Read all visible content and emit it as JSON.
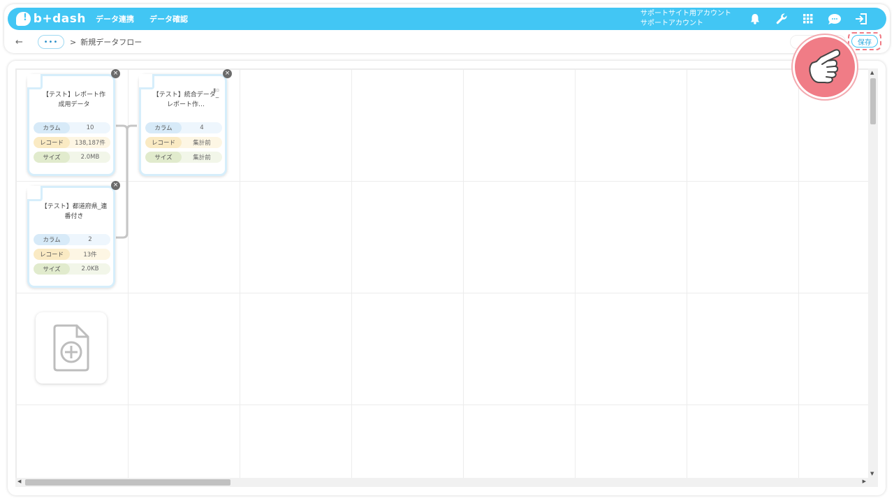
{
  "header": {
    "logo_text": "b+dash",
    "nav": [
      "データ連携",
      "データ確認"
    ],
    "account_line1": "サポートサイト用アカウント",
    "account_line2": "サポートアカウント",
    "icons": [
      "bell-icon",
      "wrench-icon",
      "grid-icon",
      "chat-icon",
      "logout-icon"
    ],
    "accent_color": "#42c6f4"
  },
  "breadcrumb": {
    "back": "←",
    "more": "•••",
    "separator": ">",
    "current": "新規データフロー"
  },
  "toolbar": {
    "save_label": "保存"
  },
  "cards": [
    {
      "title": "【テスト】レポート作成用データ",
      "rows": [
        {
          "key": "カラム",
          "value": "10"
        },
        {
          "key": "レコード",
          "value": "138,187件"
        },
        {
          "key": "サイズ",
          "value": "2.0MB"
        }
      ]
    },
    {
      "title": "【テスト】統合データ_レポート作…",
      "rows": [
        {
          "key": "カラム",
          "value": "4"
        },
        {
          "key": "レコード",
          "value": "集計前"
        },
        {
          "key": "サイズ",
          "value": "集計前"
        }
      ]
    },
    {
      "title": "【テスト】都道府県_連番付き",
      "rows": [
        {
          "key": "カラム",
          "value": "2"
        },
        {
          "key": "レコード",
          "value": "13件"
        },
        {
          "key": "サイズ",
          "value": "2.0KB"
        }
      ]
    }
  ],
  "add_source": {
    "icon": "add-file-icon"
  }
}
